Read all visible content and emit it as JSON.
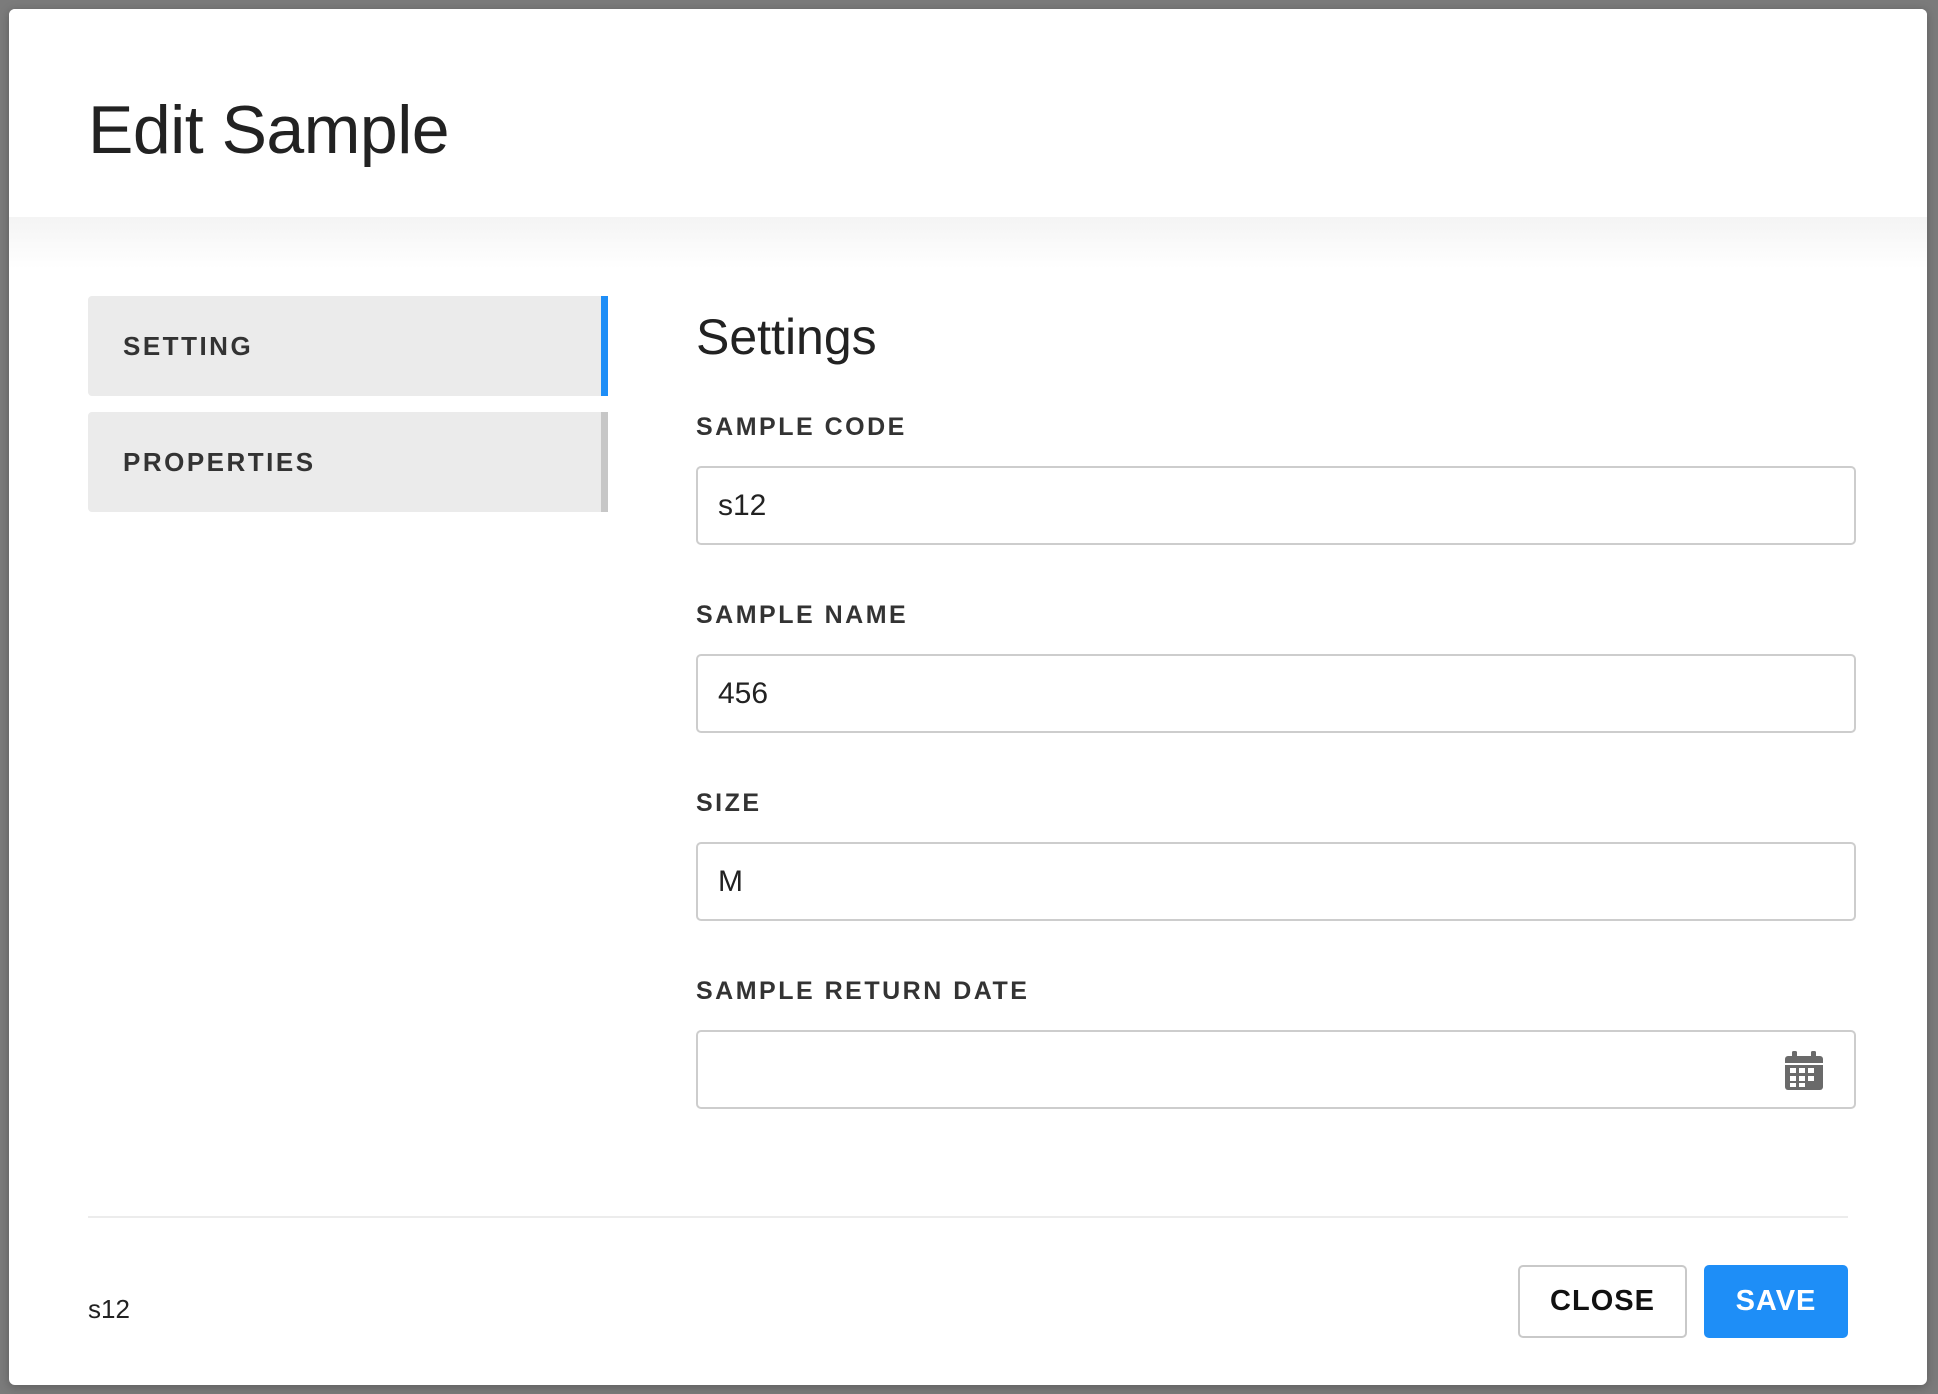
{
  "modal": {
    "title": "Edit Sample"
  },
  "sidenav": {
    "items": [
      {
        "label": "SETTING",
        "active": true
      },
      {
        "label": "PROPERTIES",
        "active": false
      }
    ]
  },
  "content": {
    "section_title": "Settings",
    "fields": [
      {
        "label": "SAMPLE CODE",
        "value": "s12"
      },
      {
        "label": "SAMPLE NAME",
        "value": "456"
      },
      {
        "label": "SIZE",
        "value": "M"
      },
      {
        "label": "SAMPLE RETURN DATE",
        "value": "",
        "icon": "calendar-icon"
      }
    ]
  },
  "footer": {
    "code": "s12",
    "close_label": "CLOSE",
    "save_label": "SAVE"
  },
  "colors": {
    "accent": "#1e8ef7",
    "nav_bg": "#ebebeb",
    "backdrop": "#7b7b7b"
  }
}
